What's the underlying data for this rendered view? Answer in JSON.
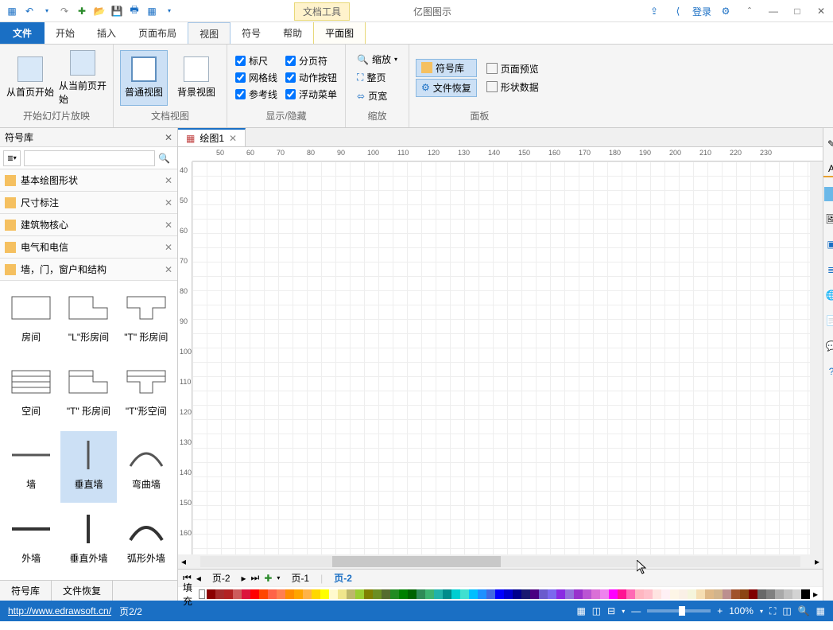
{
  "app_title": "亿图图示",
  "context_tab": "文档工具",
  "context_menu": "平面图",
  "menu": {
    "file": "文件",
    "start": "开始",
    "insert": "插入",
    "layout": "页面布局",
    "view": "视图",
    "symbol": "符号",
    "help": "帮助"
  },
  "login": "登录",
  "ribbon": {
    "slide_group": "开始幻灯片放映",
    "slide_from_first": "从首页开始",
    "slide_from_current": "从当前页开始",
    "docview_group": "文档视图",
    "normal_view": "普通视图",
    "bg_view": "背景视图",
    "show_group": "显示/隐藏",
    "ruler": "标尺",
    "page_break": "分页符",
    "gridlines": "网格线",
    "action_btn": "动作按钮",
    "guides": "参考线",
    "float_menu": "浮动菜单",
    "zoom_group": "缩放",
    "zoom": "缩放",
    "fit_page": "整页",
    "fit_width": "页宽",
    "panel_group": "面板",
    "symbol_lib": "符号库",
    "page_preview": "页面预览",
    "file_recovery": "文件恢复",
    "shape_data": "形状数据"
  },
  "library": {
    "title": "符号库",
    "cats": [
      "基本绘图形状",
      "尺寸标注",
      "建筑物核心",
      "电气和电信",
      "墙，门，窗户和结构"
    ],
    "shapes": [
      "房间",
      "\"L\"形房间",
      "\"T\" 形房间",
      "空间",
      "\"T\" 形房间",
      "\"T\"形空间",
      "墙",
      "垂直墙",
      "弯曲墙",
      "外墙",
      "垂直外墙",
      "弧形外墙"
    ],
    "tabs": {
      "lib": "符号库",
      "recovery": "文件恢复"
    }
  },
  "doc_tab": "绘图1",
  "page_tabs": {
    "prefix": "页-2",
    "p1": "页-1",
    "p2": "页-2"
  },
  "fill_label": "填充",
  "status": {
    "url": "http://www.edrawsoft.cn/",
    "page": "页2/2",
    "zoom": "100%"
  },
  "ruler_h": [
    50,
    60,
    70,
    80,
    90,
    100,
    110,
    120,
    130,
    140,
    150,
    160,
    170,
    180,
    190,
    200,
    210,
    220,
    230
  ],
  "ruler_v": [
    40,
    50,
    60,
    70,
    80,
    90,
    100,
    110,
    120,
    130,
    140,
    150,
    160
  ],
  "colors": [
    "#8b0000",
    "#a52a2a",
    "#b22222",
    "#cd5c5c",
    "#dc143c",
    "#ff0000",
    "#ff4500",
    "#ff6347",
    "#ff7f50",
    "#ff8c00",
    "#ffa500",
    "#ffb347",
    "#ffd700",
    "#ffff00",
    "#fffacd",
    "#f0e68c",
    "#bdb76b",
    "#9acd32",
    "#808000",
    "#6b8e23",
    "#556b2f",
    "#228b22",
    "#008000",
    "#006400",
    "#2e8b57",
    "#3cb371",
    "#20b2aa",
    "#008b8b",
    "#00ced1",
    "#40e0d0",
    "#00bfff",
    "#1e90ff",
    "#4169e1",
    "#0000ff",
    "#0000cd",
    "#00008b",
    "#191970",
    "#4b0082",
    "#6a5acd",
    "#7b68ee",
    "#8a2be2",
    "#9370db",
    "#9932cc",
    "#ba55d3",
    "#da70d6",
    "#ee82ee",
    "#ff00ff",
    "#ff1493",
    "#ff69b4",
    "#ffb6c1",
    "#ffc0cb",
    "#ffe4e1",
    "#fff0f5",
    "#fdf5e6",
    "#faf0e6",
    "#f5f5dc",
    "#f5deb3",
    "#deb887",
    "#d2b48c",
    "#bc8f8f",
    "#a0522d",
    "#8b4513",
    "#800000",
    "#696969",
    "#808080",
    "#a9a9a9",
    "#c0c0c0",
    "#d3d3d3",
    "#000000"
  ]
}
